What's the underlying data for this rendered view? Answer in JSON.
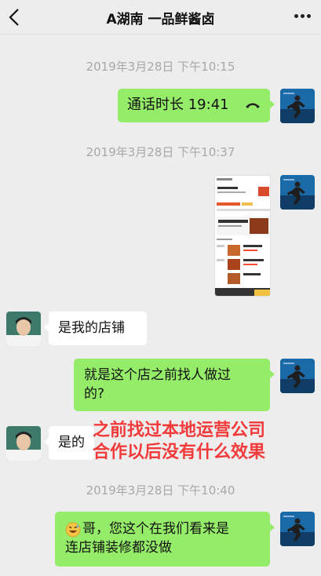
{
  "header": {
    "title": "A湖南 一品鲜酱卤",
    "back_icon": "chevron-left-icon",
    "more_icon": "more-dots-icon"
  },
  "messages": [
    {
      "type": "timestamp",
      "text": "2019年3月28日 下午10:15"
    },
    {
      "type": "call",
      "side": "me",
      "text": "通话时长 19:41",
      "icon": "phone-hangup-icon"
    },
    {
      "type": "timestamp",
      "text": "2019年3月28日 下午10:37"
    },
    {
      "type": "image",
      "side": "me",
      "alt": "store-page-screenshot"
    },
    {
      "type": "text",
      "side": "them",
      "text": "是我的店铺"
    },
    {
      "type": "text",
      "side": "me",
      "lines": [
        "就是这个店之前找人做过",
        "的?"
      ]
    },
    {
      "type": "text",
      "side": "them",
      "text": "是的"
    },
    {
      "type": "timestamp",
      "text": "2019年3月28日 下午10:40"
    },
    {
      "type": "text",
      "side": "me",
      "emoji": "sweat-grin-emoji",
      "lines": [
        "哥，您这个在我们看来是",
        "连店铺装修都没做"
      ]
    }
  ],
  "annotation": {
    "lines": [
      "之前找过本地运营公司",
      "合作以后没有什么效果"
    ],
    "color": "#f23a3a"
  },
  "colors": {
    "background": "#ededed",
    "my_bubble": "#95ec69",
    "their_bubble": "#ffffff",
    "timestamp": "#a8a8a8"
  }
}
